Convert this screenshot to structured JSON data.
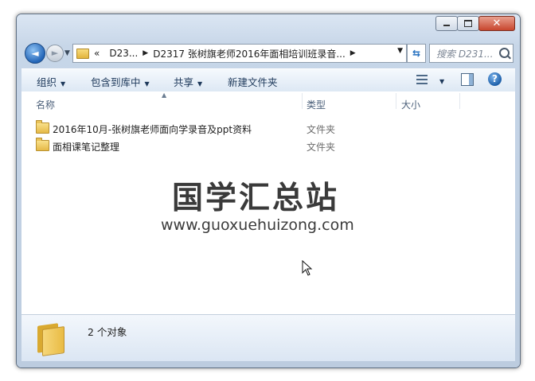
{
  "window": {
    "caption": {
      "minimize": "",
      "maximize": "",
      "close": "✕"
    }
  },
  "nav": {
    "back_glyph": "◄",
    "forward_glyph": "►",
    "breadcrumb": [
      "«",
      "D23...",
      "D2317 张树旗老师2016年面相培训班录音..."
    ],
    "search_placeholder": "搜索 D231..."
  },
  "toolbar": {
    "organize": "组织",
    "include_in_library": "包含到库中",
    "share": "共享",
    "new_folder": "新建文件夹",
    "help": "?"
  },
  "columns": {
    "name": "名称",
    "type": "类型",
    "size": "大小"
  },
  "files": [
    {
      "name": "2016年10月-张树旗老师面向学录音及ppt资料",
      "type": "文件夹"
    },
    {
      "name": "面相课笔记整理",
      "type": "文件夹"
    }
  ],
  "watermark": {
    "title": "国学汇总站",
    "url": "www.guoxuehuizong.com"
  },
  "details": {
    "count": "2 个对象"
  }
}
